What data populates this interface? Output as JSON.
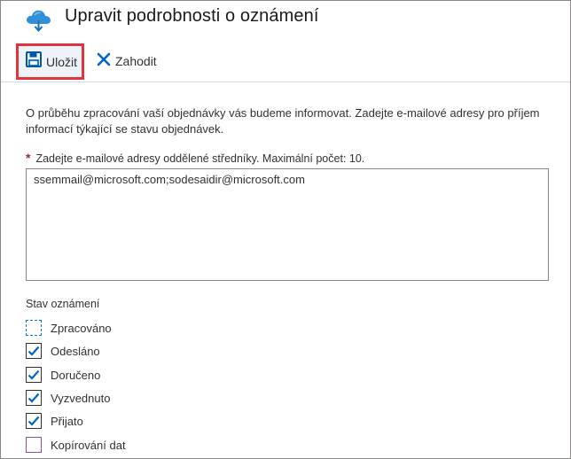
{
  "header": {
    "title": "Upravit podrobnosti o oznámení",
    "icon": "cloud-upload-icon"
  },
  "toolbar": {
    "save_label": "Uložit",
    "save_icon": "save-icon",
    "discard_label": "Zahodit",
    "discard_icon": "close-icon",
    "highlight_color": "#e2343f",
    "accent_color": "#0078d4"
  },
  "form": {
    "description": "O průběhu zpracování vaší objednávky vás budeme informovat. Zadejte e-mailové adresy pro příjem informací týkající se stavu objednávek.",
    "email_required_marker": "*",
    "email_label": "Zadejte e-mailové adresy oddělené středníky. Maximální počet: 10.",
    "email_value": "ssemmail@microsoft.com;sodesaidir@microsoft.com",
    "status_heading": "Stav oznámení",
    "statuses": [
      {
        "label": "Zpracováno",
        "checked": false
      },
      {
        "label": "Odesláno",
        "checked": true
      },
      {
        "label": "Doručeno",
        "checked": true
      },
      {
        "label": "Vyzvednuto",
        "checked": true
      },
      {
        "label": "Přijato",
        "checked": true
      },
      {
        "label": "Kopírování dat",
        "checked": false
      }
    ]
  }
}
